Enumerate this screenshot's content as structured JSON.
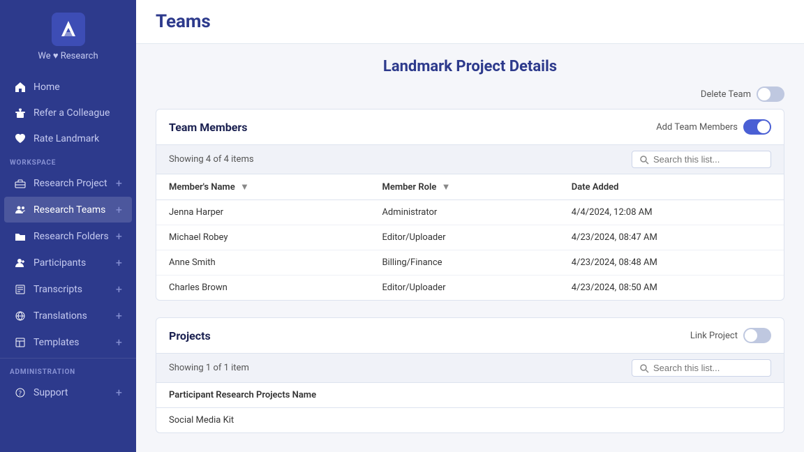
{
  "app": {
    "logo_text": "We ♥ Research",
    "page_title": "Teams"
  },
  "sidebar": {
    "section_workspace": "WORKSPACE",
    "section_admin": "ADMINISTRATION",
    "nav_items": [
      {
        "id": "home",
        "label": "Home",
        "icon": "home",
        "plus": false
      },
      {
        "id": "refer",
        "label": "Refer a Colleague",
        "icon": "gift",
        "plus": false
      },
      {
        "id": "rate",
        "label": "Rate Landmark",
        "icon": "heart",
        "plus": false
      }
    ],
    "workspace_items": [
      {
        "id": "research-project",
        "label": "Research Project",
        "icon": "briefcase",
        "plus": true
      },
      {
        "id": "research-teams",
        "label": "Research Teams",
        "icon": "users",
        "plus": true
      },
      {
        "id": "research-folders",
        "label": "Research Folders",
        "icon": "folder",
        "plus": true
      },
      {
        "id": "participants",
        "label": "Participants",
        "icon": "person-plus",
        "plus": true
      },
      {
        "id": "transcripts",
        "label": "Transcripts",
        "icon": "edit",
        "plus": true
      },
      {
        "id": "translations",
        "label": "Translations",
        "icon": "globe",
        "plus": true
      },
      {
        "id": "templates",
        "label": "Templates",
        "icon": "template",
        "plus": true
      }
    ],
    "admin_items": [
      {
        "id": "support",
        "label": "Support",
        "icon": "question",
        "plus": true
      }
    ]
  },
  "main": {
    "project_details_title": "Landmark Project Details",
    "delete_team_label": "Delete Team",
    "team_members_section": "Team Members",
    "add_team_members_label": "Add Team Members",
    "showing_members": "Showing 4 of 4 items",
    "search_placeholder": "Search this list...",
    "columns": [
      "Member's Name",
      "Member Role",
      "Date Added"
    ],
    "members": [
      {
        "name": "Jenna Harper",
        "role": "Administrator",
        "date": "4/4/2024, 12:08 AM"
      },
      {
        "name": "Michael Robey",
        "role": "Editor/Uploader",
        "date": "4/23/2024, 08:47 AM"
      },
      {
        "name": "Anne Smith",
        "role": "Billing/Finance",
        "date": "4/23/2024, 08:48 AM"
      },
      {
        "name": "Charles Brown",
        "role": "Editor/Uploader",
        "date": "4/23/2024, 08:50 AM"
      }
    ],
    "projects_section": "Projects",
    "link_project_label": "Link Project",
    "showing_projects": "Showing 1 of 1 item",
    "project_search_placeholder": "Search this list...",
    "project_columns": [
      "Participant Research Projects Name"
    ],
    "projects": [
      {
        "name": "Social Media Kit"
      }
    ]
  }
}
